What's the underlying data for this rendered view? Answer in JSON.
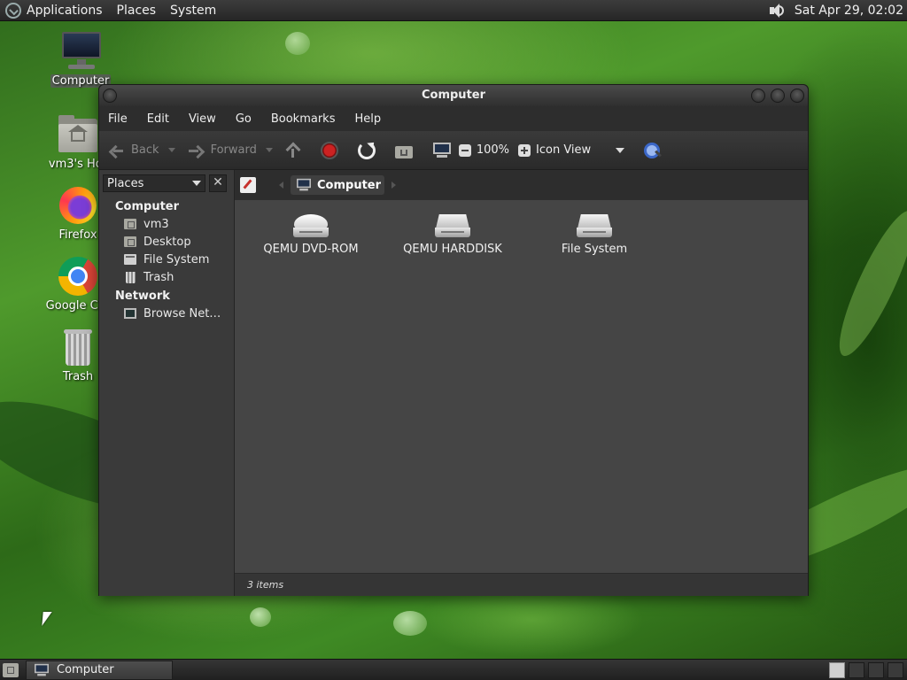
{
  "top_panel": {
    "menus": [
      "Applications",
      "Places",
      "System"
    ],
    "clock": "Sat Apr 29, 02:02",
    "icons": [
      "distro-logo-icon",
      "volume-icon"
    ]
  },
  "desktop": {
    "icons": [
      {
        "label": "Computer",
        "icon": "computer-icon",
        "selected": true
      },
      {
        "label": "vm3's Hor",
        "icon": "home-folder-icon"
      },
      {
        "label": "Firefox",
        "icon": "firefox-icon"
      },
      {
        "label": "Google Chr",
        "icon": "chrome-icon"
      },
      {
        "label": "Trash",
        "icon": "trash-icon"
      }
    ]
  },
  "window": {
    "title": "Computer",
    "menubar": [
      "File",
      "Edit",
      "View",
      "Go",
      "Bookmarks",
      "Help"
    ],
    "toolbar": {
      "back": "Back",
      "forward": "Forward",
      "zoom": "100%",
      "view_mode": "Icon View"
    },
    "sidebar": {
      "selector": "Places",
      "close": "✕",
      "sections": [
        {
          "title": "Computer",
          "items": [
            {
              "label": "vm3",
              "icon": "home-folder-icon"
            },
            {
              "label": "Desktop",
              "icon": "desktop-folder-icon"
            },
            {
              "label": "File System",
              "icon": "filesystem-icon"
            },
            {
              "label": "Trash",
              "icon": "trash-icon"
            }
          ]
        },
        {
          "title": "Network",
          "items": [
            {
              "label": "Browse Net…",
              "icon": "network-icon"
            }
          ]
        }
      ]
    },
    "pathbar": {
      "current": "Computer"
    },
    "files": [
      {
        "label": "QEMU DVD-ROM",
        "icon": "dvd-drive-icon"
      },
      {
        "label": "QEMU HARDDISK",
        "icon": "harddisk-icon"
      },
      {
        "label": "File System",
        "icon": "filesystem-drive-icon"
      }
    ],
    "status": "3 items"
  },
  "bottom_panel": {
    "task": "Computer",
    "workspaces": 4,
    "active_workspace": 1
  }
}
